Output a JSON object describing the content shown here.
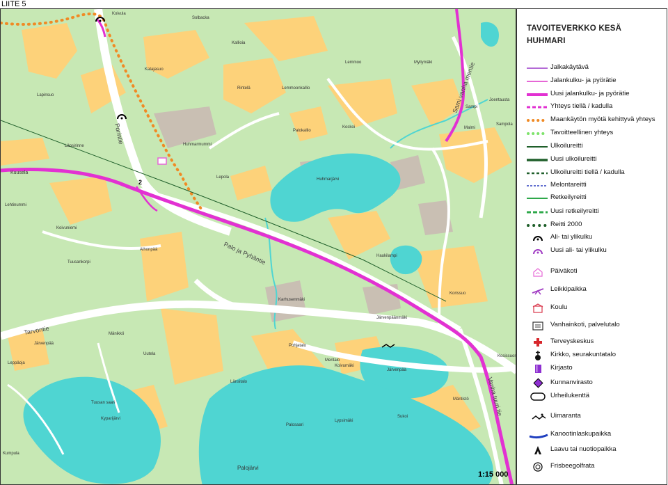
{
  "page_label": "LIITE 5",
  "legend": {
    "title_line1": "TAVOITEVERKKO KESÄ",
    "title_line2": "HUHMARI",
    "items": [
      {
        "label": "Jalkakäytävä",
        "icon": "line-purple-thin",
        "color": "#b36ad6"
      },
      {
        "label": "Jalankulku- ja pyörätie",
        "icon": "line-magenta-thin",
        "color": "#e667d6"
      },
      {
        "label": "Uusi jalankulku- ja pyörätie",
        "icon": "line-magenta-thick",
        "color": "#e231d2"
      },
      {
        "label": "Yhteys tiellä / kadulla",
        "icon": "line-magenta-dashed",
        "color": "#e231d2"
      },
      {
        "label": "Maankäytön myötä kehittyvä yhteys",
        "icon": "line-orange-dotted",
        "color": "#f08a24"
      },
      {
        "label": "Tavoitteellinen yhteys",
        "icon": "line-lightgreen-dotted",
        "color": "#7ee36b"
      },
      {
        "label": "Ulkoilureitti",
        "icon": "line-darkgreen",
        "color": "#1f5f2a"
      },
      {
        "label": "Uusi ulkoilureitti",
        "icon": "line-darkgreen-thick",
        "color": "#1f5f2a"
      },
      {
        "label": "Ulkoilureitti tiellä / kadulla",
        "icon": "line-darkgreen-dashed",
        "color": "#1f5f2a"
      },
      {
        "label": "Melontareitti",
        "icon": "line-blue-dashed",
        "color": "#2d3fbf"
      },
      {
        "label": "Retkeilyreitti",
        "icon": "line-green",
        "color": "#2ea84a"
      },
      {
        "label": "Uusi retkeilyreitti",
        "icon": "line-green-dashed",
        "color": "#2ea84a"
      },
      {
        "label": "Reitti 2000",
        "icon": "line-darkgreen-dots",
        "color": "#1f5f2a"
      },
      {
        "label": "Ali- tai ylikulku",
        "icon": "underpass-icon",
        "color": "#000000"
      },
      {
        "label": "Uusi ali- tai ylikulku",
        "icon": "new-underpass-icon",
        "color": "#a23fc4"
      },
      {
        "label": "Päiväkoti",
        "icon": "kindergarten-icon",
        "color": "#e667d6"
      },
      {
        "label": "Leikkipaikka",
        "icon": "playground-icon",
        "color": "#a23fc4"
      },
      {
        "label": "Koulu",
        "icon": "school-icon",
        "color": "#d9364a"
      },
      {
        "label": "Vanhainkoti, palvelutalo",
        "icon": "care-home-icon",
        "color": "#333333"
      },
      {
        "label": "Terveyskeskus",
        "icon": "health-center-icon",
        "color": "#d7262b"
      },
      {
        "label": "Kirkko, seurakuntatalo",
        "icon": "church-icon",
        "color": "#111111"
      },
      {
        "label": "Kirjasto",
        "icon": "library-icon",
        "color": "#8e2fd1"
      },
      {
        "label": "Kunnanvirasto",
        "icon": "municipal-office-icon",
        "color": "#8e2fd1"
      },
      {
        "label": "Urheilukenttä",
        "icon": "sports-field-icon",
        "color": "#111111"
      },
      {
        "label": "Uimaranta",
        "icon": "beach-icon",
        "color": "#111111"
      },
      {
        "label": "Kanootinlaskupaikka",
        "icon": "canoe-launch-icon",
        "color": "#1f3fbf"
      },
      {
        "label": "Laavu tai nuotiopaikka",
        "icon": "shelter-icon",
        "color": "#111111"
      },
      {
        "label": "Frisbeegolfrata",
        "icon": "disc-golf-icon",
        "color": "#111111"
      }
    ]
  },
  "scale": "1:15 000",
  "map": {
    "colors": {
      "forest": "#c7e8b4",
      "residential": "#fdd27a",
      "built": "#c9bfb3",
      "water": "#4fd5d2",
      "road": "#ffffff",
      "cycle": "#e231d2",
      "cycle_orange": "#f08a24"
    },
    "places": [
      "Koivula",
      "Solbacka",
      "Kallioia",
      "Katajasuo",
      "Lapinsuo",
      "Rintelä",
      "Lemmoonkallio",
      "Lemmoo",
      "Myllymäki",
      "Joentausta",
      "Sampi",
      "Sampola",
      "Malmi",
      "Koskoi",
      "Palokallio",
      "Huhmarmummi",
      "Länsirinne",
      "Kuusela",
      "Lepola",
      "Huhmarjärvi",
      "Lehtinummi",
      "Koivuniemi",
      "Alhonpää",
      "Haukilampi",
      "Tuusankorpi",
      "Karhusenmäki",
      "Korissuo",
      "Järvenpäänmäki",
      "Mänikkö",
      "Järvenpää",
      "Leppäoja",
      "Uutela",
      "Pohjatalo",
      "Meritalo",
      "Koivumäki",
      "Länsitalo",
      "Tuusan saari",
      "Kypärijärvi",
      "Palosaari",
      "Lypsimäki",
      "Mäntistö",
      "Sukoi",
      "Kumpula",
      "Palojärvi",
      "Kosissuon"
    ],
    "roads": [
      "Porintie",
      "Tarvontie",
      "Palo ja Pyhäntie",
      "Vanha tuuri tie",
      "Sami vanha mentie"
    ],
    "crossing_number": "2"
  }
}
